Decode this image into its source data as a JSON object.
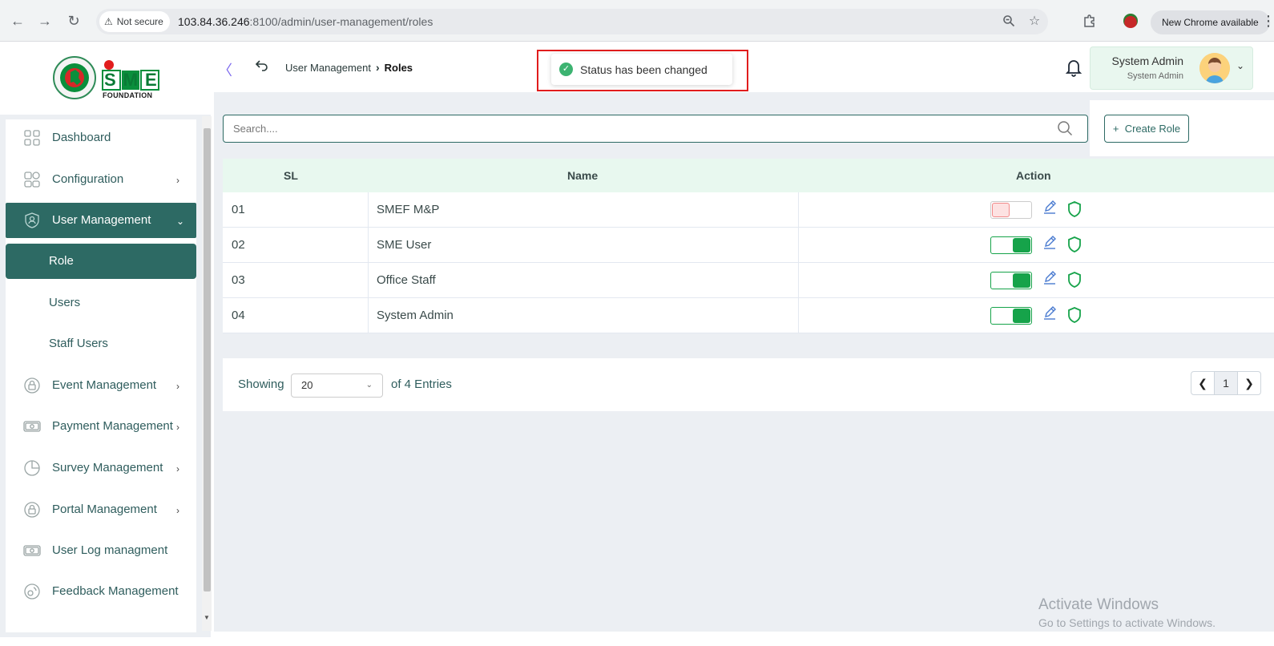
{
  "browser": {
    "security_label": "Not secure",
    "url_host": "103.84.36.246",
    "url_rest": ":8100/admin/user-management/roles",
    "update_label": "New Chrome available"
  },
  "header": {
    "breadcrumb": [
      "User Management",
      "Roles"
    ],
    "toast_message": "Status has been changed",
    "user_name": "System Admin",
    "user_role": "System Admin"
  },
  "logo": {
    "brand": "SME",
    "sub": "FOUNDATION"
  },
  "sidebar": {
    "items": [
      {
        "label": "Dashboard",
        "icon": "dashboard-grid-icon"
      },
      {
        "label": "Configuration",
        "icon": "config-icon"
      },
      {
        "label": "User Management",
        "icon": "user-shield-icon"
      },
      {
        "label": "Role"
      },
      {
        "label": "Users"
      },
      {
        "label": "Staff Users"
      },
      {
        "label": "Event Management",
        "icon": "lock-circle-icon"
      },
      {
        "label": "Payment Management",
        "icon": "cash-icon"
      },
      {
        "label": "Survey Management",
        "icon": "pie-icon"
      },
      {
        "label": "Portal Management",
        "icon": "lock-circle-icon"
      },
      {
        "label": "User Log managment",
        "icon": "cash-icon"
      },
      {
        "label": "Feedback Management",
        "icon": "feedback-icon"
      }
    ]
  },
  "main": {
    "search_placeholder": "Search....",
    "create_label": "Create Role",
    "columns": [
      "SL",
      "Name",
      "Action"
    ],
    "rows": [
      {
        "sl": "01",
        "name": "SMEF M&P",
        "active": false
      },
      {
        "sl": "02",
        "name": "SME User",
        "active": true
      },
      {
        "sl": "03",
        "name": "Office Staff",
        "active": true
      },
      {
        "sl": "04",
        "name": "System Admin",
        "active": true
      }
    ],
    "showing_label": "Showing",
    "per_page": "20",
    "entries_label": "of 4 Entries",
    "current_page": "1"
  },
  "watermark": {
    "line1": "Activate Windows",
    "line2": "Go to Settings to activate Windows."
  },
  "colors": {
    "brand": "#2d6a64",
    "active_toggle": "#16a34a",
    "inactive_toggle": "#fde2e2",
    "toast_frame": "#e11d1d",
    "table_header": "#e8f8ef"
  }
}
